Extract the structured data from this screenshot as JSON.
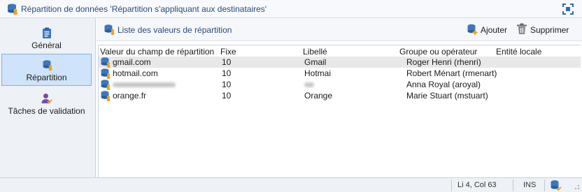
{
  "window": {
    "title": "Répartition de données 'Répartition s'appliquant aux destinataires'"
  },
  "sidebar": {
    "items": [
      {
        "label": "Général",
        "icon": "clipboard-icon"
      },
      {
        "label": "Répartition",
        "icon": "database-users-icon",
        "active": true
      },
      {
        "label": "Tâches de validation",
        "icon": "user-check-icon"
      }
    ]
  },
  "toolbar": {
    "list_title": "Liste des valeurs de répartition",
    "add_label": "Ajouter",
    "delete_label": "Supprimer"
  },
  "table": {
    "columns": [
      "Valeur du champ de répartition",
      "Fixe",
      "Libellé",
      "Groupe ou opérateur",
      "Entité locale"
    ],
    "rows": [
      {
        "value": "gmail.com",
        "fixe": "10",
        "libelle": "Gmail",
        "groupe": "Roger Henri (rhenri)",
        "entite": ""
      },
      {
        "value": "hotmail.com",
        "fixe": "10",
        "libelle": "Hotmai",
        "groupe": "Robert Ménart (rmenart)",
        "entite": ""
      },
      {
        "value": "",
        "fixe": "10",
        "libelle": "",
        "groupe": "Anna Royal (aroyal)",
        "entite": ""
      },
      {
        "value": "orange.fr",
        "fixe": "10",
        "libelle": "Orange",
        "groupe": "Marie Stuart (mstuart)",
        "entite": ""
      }
    ]
  },
  "status": {
    "position": "Li 4, Col 63",
    "mode": "INS"
  },
  "colors": {
    "accent": "#2b4a7a",
    "selected_nav": "#cfe3fa",
    "icon_blue": "#3a78c2",
    "icon_orange": "#f0a020"
  }
}
